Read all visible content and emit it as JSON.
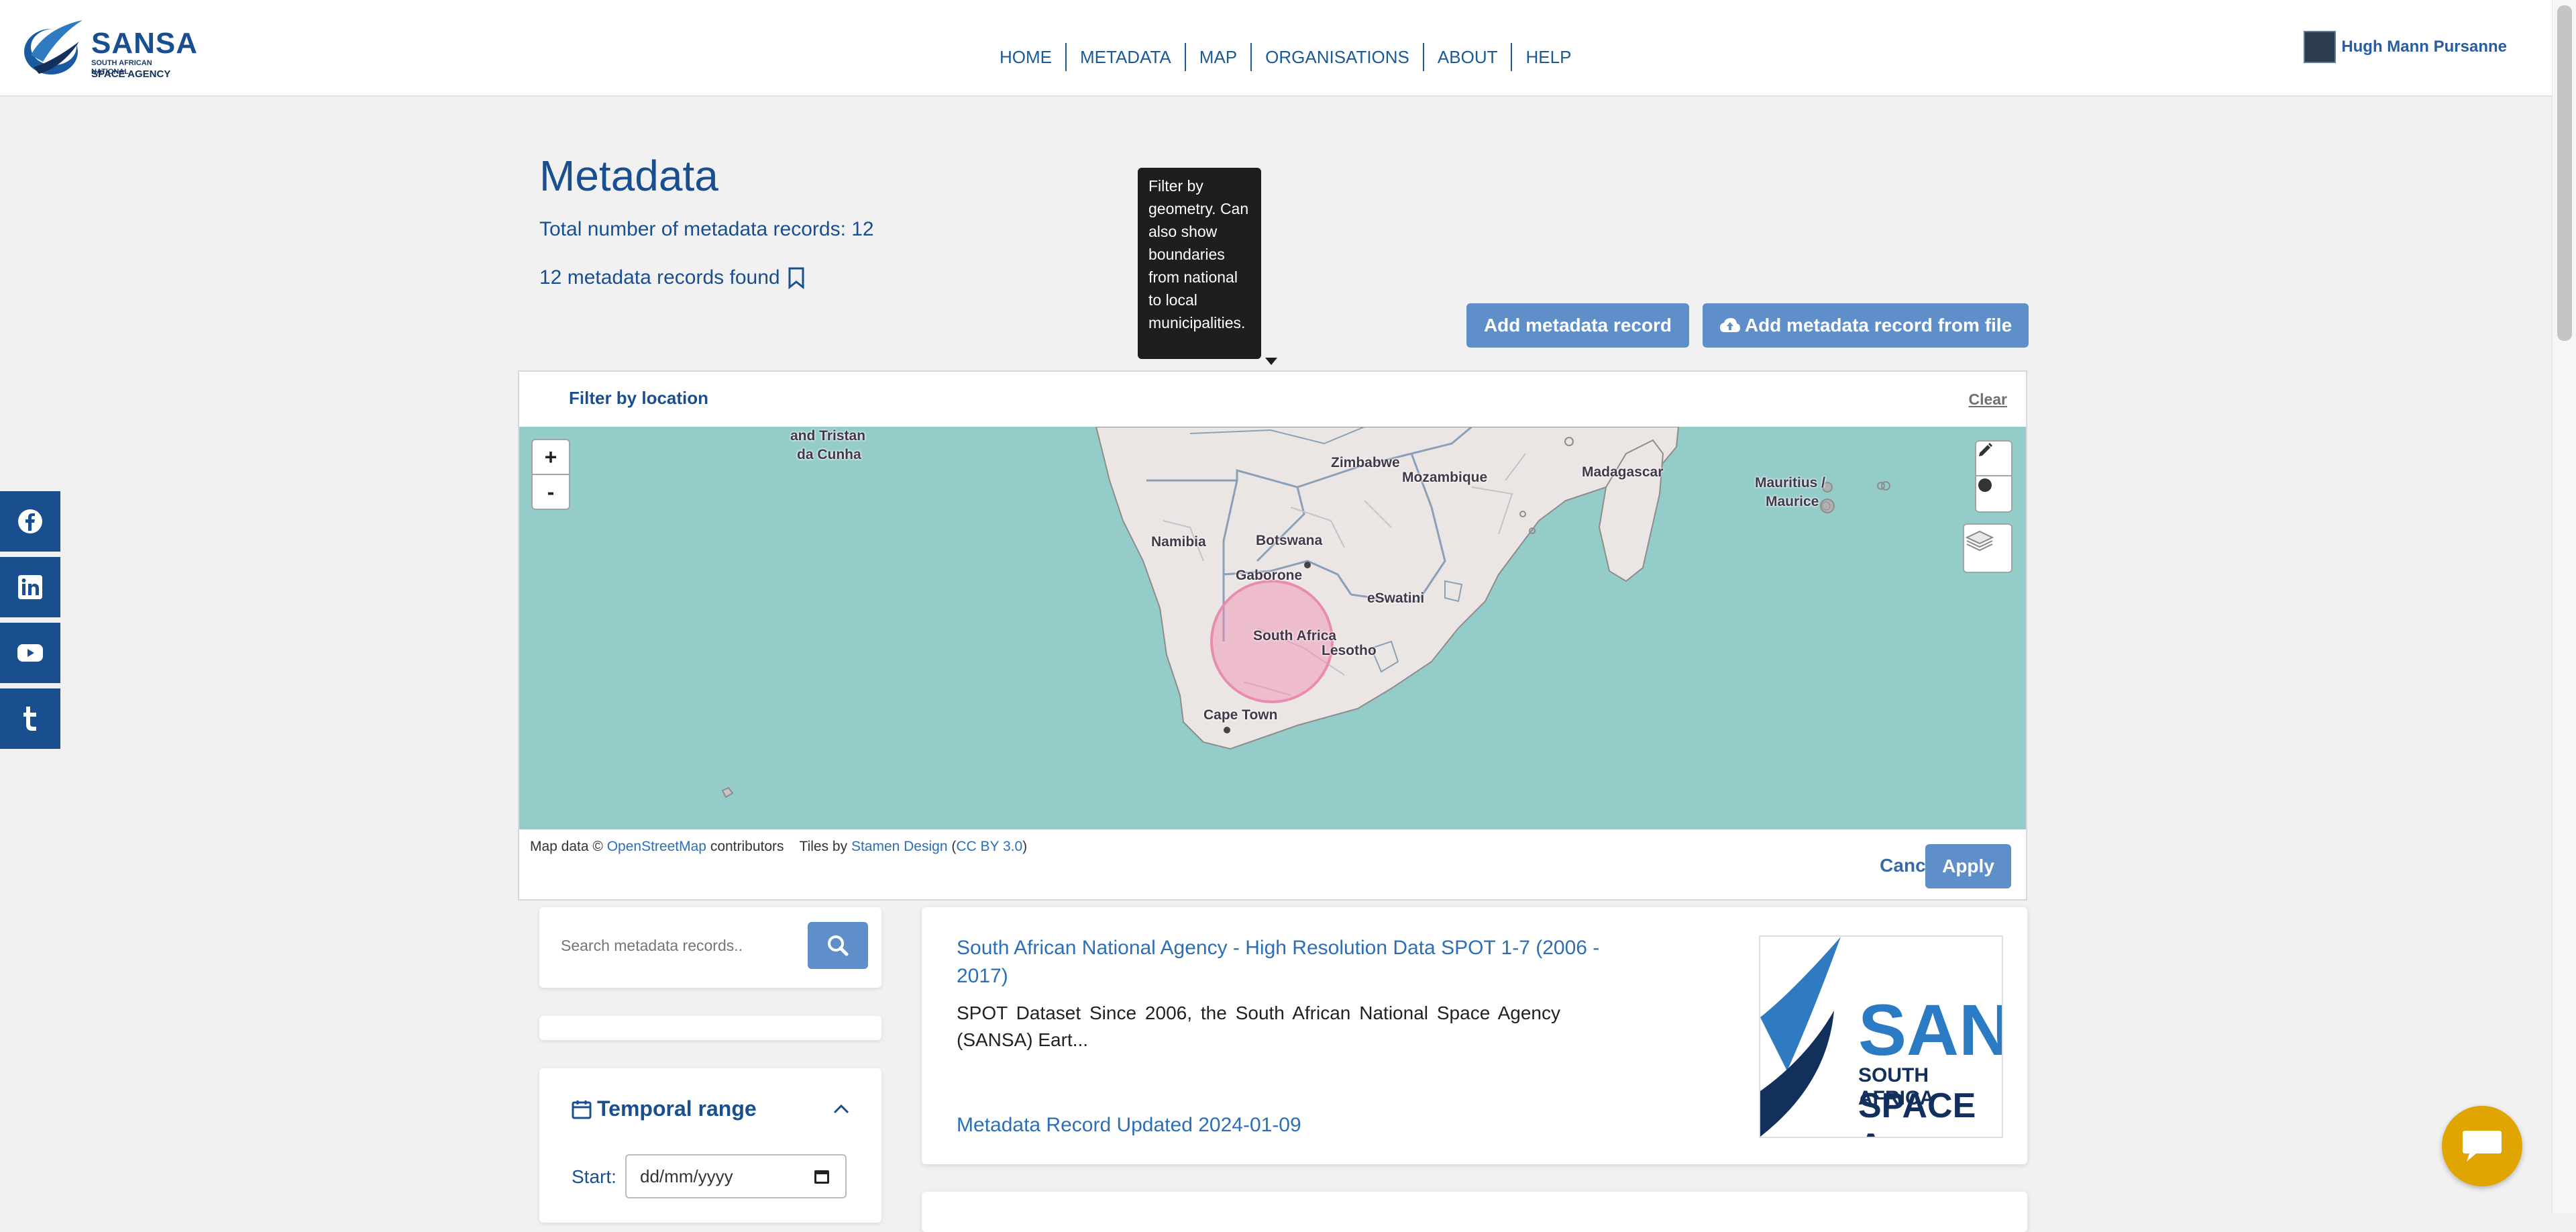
{
  "header": {
    "logo_text": "SANSA",
    "logo_subtitle": "SOUTH AFRICAN NATIONAL",
    "logo_subtitle2": "SPACE AGENCY",
    "nav": [
      "HOME",
      "METADATA",
      "MAP",
      "ORGANISATIONS",
      "ABOUT",
      "HELP"
    ],
    "user_name": "Hugh Mann Pursanne"
  },
  "social": [
    "facebook-icon",
    "linkedin-icon",
    "youtube-icon",
    "tumblr-icon"
  ],
  "page": {
    "title": "Metadata",
    "total": "Total number of metadata records: 12",
    "found": "12 metadata records found"
  },
  "tooltip": "Filter by geometry. Can also show boundaries from national to local municipalities.",
  "buttons": {
    "add_record": "Add metadata record",
    "add_from_file": "Add metadata record from file"
  },
  "filter": {
    "label": "Filter by location",
    "clear": "Clear",
    "zoom_in": "+",
    "zoom_out": "-",
    "cancel": "Cancel",
    "apply": "Apply",
    "attribution": {
      "prefix": "Map data ©",
      "osm": "OpenStreetMap",
      "contributors": "contributors",
      "tiles": "Tiles by",
      "stamen": "Stamen Design",
      "license": "CC BY 3.0"
    },
    "map_labels": {
      "tristan": "and Tristan",
      "cunha": "da Cunha",
      "zimbabwe": "Zimbabwe",
      "mozambique": "Mozambique",
      "madagascar": "Madagascar",
      "mauritius": "Mauritius /",
      "maurice": "Maurice",
      "namibia": "Namibia",
      "botswana": "Botswana",
      "gaborone": "Gaborone",
      "eswatini": "eSwatini",
      "south_africa": "South Africa",
      "lesotho": "Lesotho",
      "cape_town": "Cape Town"
    }
  },
  "search": {
    "placeholder": "Search metadata records.."
  },
  "temporal": {
    "title": "Temporal range",
    "start_label": "Start:",
    "start_placeholder": "dd/mm/yyyy"
  },
  "results": [
    {
      "title": "South African National Agency - High Resolution Data SPOT 1-7 (2006 - 2017)",
      "description": "SPOT Dataset Since 2006, the South African National Space Agency (SANSA) Eart...",
      "updated": "Metadata Record Updated 2024-01-09",
      "logo_text": "SAN",
      "logo_sub1": "SOUTH AFRICA",
      "logo_sub2": "SPACE A"
    }
  ],
  "colors": {
    "brand": "#1a4f8f",
    "button": "#5e8fc8",
    "map_water": "#94ccca",
    "chat": "#e0a500"
  }
}
